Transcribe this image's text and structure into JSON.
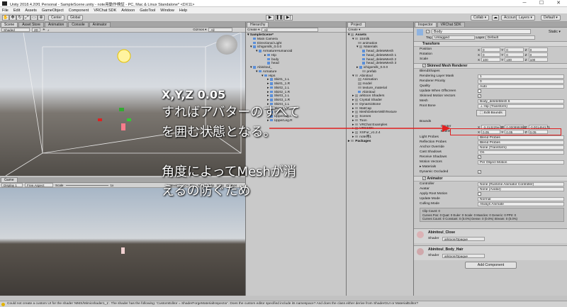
{
  "window": {
    "title": "Unity 2018.4.20f1 Personal - SampleScene.unity - note用動作検証 - PC, Mac & Linux Standalone* <DX11>",
    "minimize": "─",
    "maximize": "☐",
    "close": "✕"
  },
  "menu": [
    "File",
    "Edit",
    "Assets",
    "GameObject",
    "Component",
    "VRChat SDK",
    "Arktoon",
    "GatoTool",
    "Window",
    "Help"
  ],
  "toolbar": {
    "center": "Center",
    "global": "Global",
    "play": "▶",
    "pause": "❚❚",
    "step": "▶|",
    "collab": "Collab ▾",
    "cloud": "☁",
    "account": "Account ▾",
    "layers": "Layers ▾",
    "layout": "Default ▾"
  },
  "scene_panel": {
    "tabs": [
      "Scene",
      "Asset Store",
      "Animation",
      "Console",
      "Animator"
    ],
    "shading": "Shaded",
    "mode": "2D",
    "gizmos": "Gizmos ▾",
    "search": "All"
  },
  "game_panel": {
    "tab": "Game",
    "display": "Display 1",
    "aspect": "Free Aspect",
    "scale_label": "Scale",
    "scale_value": "1x",
    "maximize": "Maximize On Play",
    "mute": "Mute Audio",
    "stats": "Stats",
    "gizmos": "Gizmos"
  },
  "overlay": {
    "heading": "X,Y,Z 0.05",
    "line1": "すればアバターのすべて",
    "line2": "を囲む状態となる。",
    "line3": "角度によってMeshが消",
    "line4": "えるの防ぐため"
  },
  "hierarchy": {
    "tab": "Hierarchy",
    "create": "Create ▾",
    "search": "All",
    "items": [
      "SampleScene*",
      "Main Camera",
      "Directional Light",
      "ichigomilk_0.0.0",
      "ArmatureHumanoid",
      "Hip",
      "body",
      "head",
      "Abinitoul_",
      "Armature",
      "Hips",
      "Skirt1_1.L",
      "Skirt1_1.R",
      "Skirt2_1.L",
      "Skirt2_1.R",
      "Skirt3_1.L",
      "Skirt3_1.R",
      "Skirt4_1.L",
      "Skirt4_1.R",
      "Spine",
      "UpperLeg.L",
      "UpperLeg.R"
    ]
  },
  "project": {
    "tab": "Project",
    "create": "Create ▾",
    "items": [
      "Assets",
      "15milk",
      "animation",
      "Materials",
      "head_deleteMesh",
      "head_deleteMesh 1",
      "head_deleteMesh 2",
      "head_deleteMesh 3",
      "ichigomilk_0.0.0",
      "prefab",
      "Abinitoul",
      "Animation",
      "model",
      "texture_material",
      "Abinitoul",
      "arktoon Shaders",
      "Crystal Shader",
      "DynamicBone",
      "MatCap",
      "MeshDeleterWithTexture",
      "Scenes",
      "Toon",
      "VRChat Examples",
      "VRCSDK",
      "XSFur_v1.2.4",
      "note用1",
      "Packages"
    ]
  },
  "inspector": {
    "tabs": [
      "Inspector",
      "VRChat SDK"
    ],
    "object_name": "Body",
    "static": "Static ▾",
    "tag_label": "Tag",
    "tag": "Untagged",
    "layer_label": "Layer",
    "layer": "Default",
    "transform": {
      "title": "Transform",
      "position": [
        "0",
        "0",
        "0"
      ],
      "rotation": [
        "0",
        "0",
        "0"
      ],
      "scale": [
        "100",
        "100",
        "100"
      ]
    },
    "smr": {
      "title": "Skinned Mesh Renderer",
      "blendshapes": "BlendShapes",
      "rendering_layer_mask": "1",
      "renderer_priority": "0",
      "quality": "Auto",
      "update_offscreen": "",
      "skinned_motion": "✓",
      "mesh": "Body_deleteMesh 6",
      "root_bone": "⊥ Hip (Transform)",
      "edit_bounds": "Edit Bounds",
      "bounds": "Bounds",
      "center": [
        "-3.313229e-10",
        "0.000999362",
        "-0.001464171"
      ],
      "extent": [
        "0.05",
        "0.05",
        "0.05"
      ],
      "light_probes": "Blend Probes",
      "reflection_probes": "Blend Probes",
      "anchor_override": "None (Transform)",
      "cast_shadows": "On",
      "receive_shadows": "✓",
      "motion_vectors": "Per Object Motion",
      "materials": "Materials",
      "dynamic_occluded": "✓"
    },
    "labels": {
      "position": "Position",
      "rotation": "Rotation",
      "scale": "Scale",
      "rendering_layer_mask": "Rendering Layer Mask",
      "renderer_priority": "Renderer Priority",
      "quality": "Quality",
      "update_offscreen": "Update When Offscreen",
      "skinned_motion": "Skinned Motion Vectors",
      "mesh": "Mesh",
      "root_bone": "Root Bone",
      "center": "Center",
      "extent": "Extent",
      "light_probes": "Light Probes",
      "reflection_probes": "Reflection Probes",
      "anchor_override": "Anchor Override",
      "cast_shadows": "Cast Shadows",
      "receive_shadows": "Receive Shadows",
      "motion_vectors": "Motion Vectors",
      "dynamic_occluded": "Dynamic Occluded",
      "controller": "Controller",
      "avatar": "Avatar",
      "apply_root": "Apply Root Motion",
      "update_mode": "Update Mode",
      "culling_mode": "Culling Mode"
    },
    "animator": {
      "title": "Animator",
      "controller": "None (Runtime Animator Controller)",
      "avatar": "None (Avatar)",
      "apply_root": "",
      "update_mode": "Normal",
      "culling_mode": "Always Animate",
      "info": [
        "Clip Count: 0",
        "Curves Pos: 0 Quat: 0 Euler: 0 Scale: 0 Muscles: 0 Generic: 0 PPtr: 0",
        "Curves Count: 0 Constant: 0 (0.0%) Dense: 0 (0.0%) Stream: 0 (0.0%)"
      ]
    },
    "materials": [
      {
        "name": "Abinitoul_Close",
        "shader_label": "Shader",
        "shader": "arktoon/Opaque"
      },
      {
        "name": "Abinitoul_Body_Hair",
        "shader_label": "Shader",
        "shader": "arktoon/Opaque"
      }
    ],
    "add_component": "Add Component"
  },
  "status": "Could not create a custom UI for the shader 'MMS/Mimicshader1_1'. The shader has the following: 'CustomEditor = ShaderForgeMaterialInspector'. Does the custom editor specified include its namespace? And does the class either derive from ShaderGUI or MaterialEditor?",
  "colors": {
    "highlight": "#e02020",
    "selection": "#3d78c9",
    "accent": "#fa7c8c"
  }
}
